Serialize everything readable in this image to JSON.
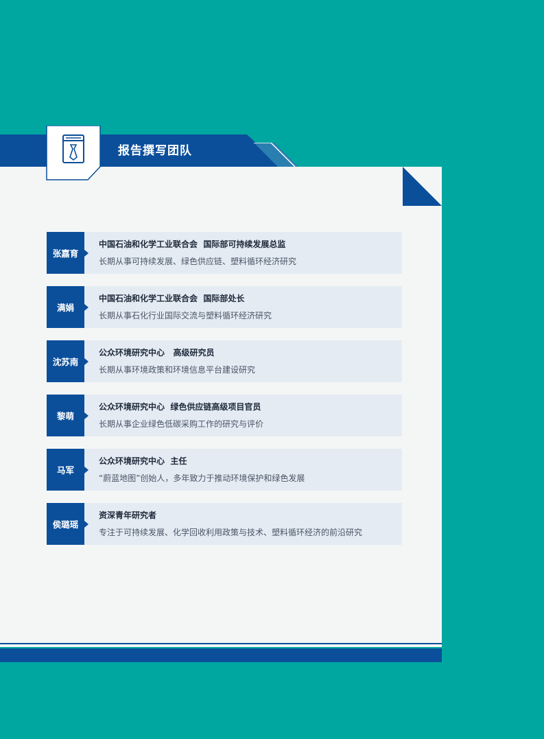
{
  "header": {
    "title": "报告撰写团队",
    "icon": "book-icon"
  },
  "colors": {
    "background": "#00a7a0",
    "accent": "#0b4f9b",
    "card": "#e4ebf3"
  },
  "members": [
    {
      "name": "张嘉育",
      "title": "中国石油和化学工业联合会  国际部可持续发展总监",
      "desc": "长期从事可持续发展、绿色供应链、塑料循环经济研究"
    },
    {
      "name": "满娟",
      "title": "中国石油和化学工业联合会  国际部处长",
      "desc": "长期从事石化行业国际交流与塑料循环经济研究"
    },
    {
      "name": "沈苏南",
      "title": "公众环境研究中心   高级研究员",
      "desc": "长期从事环境政策和环境信息平台建设研究"
    },
    {
      "name": "黎萌",
      "title": "公众环境研究中心  绿色供应链高级项目官员",
      "desc": "长期从事企业绿色低碳采购工作的研究与评价"
    },
    {
      "name": "马军",
      "title": "公众环境研究中心  主任",
      "desc": "“蔚蓝地图”创始人，多年致力于推动环境保护和绿色发展"
    },
    {
      "name": "侯璐瑶",
      "title": "资深青年研究者",
      "desc": "专注于可持续发展、化学回收利用政策与技术、塑料循环经济的前沿研究"
    }
  ]
}
